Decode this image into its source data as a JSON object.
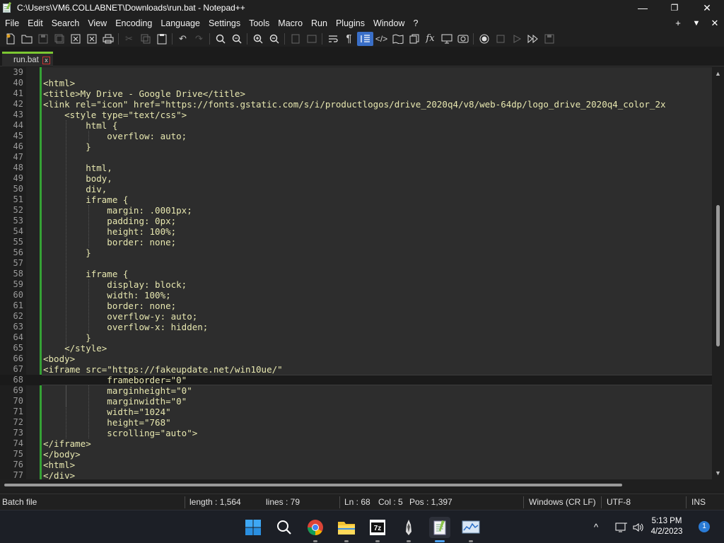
{
  "window": {
    "title": "C:\\Users\\VM6.COLLABNET\\Downloads\\run.bat - Notepad++",
    "controls": {
      "minimize": "—",
      "maximize": "❐",
      "close": "✕"
    }
  },
  "menu": {
    "items": [
      "File",
      "Edit",
      "Search",
      "View",
      "Encoding",
      "Language",
      "Settings",
      "Tools",
      "Macro",
      "Run",
      "Plugins",
      "Window",
      "?"
    ],
    "right": {
      "new_tab": "+",
      "dropdown": "▼",
      "close": "✕"
    }
  },
  "toolbar": {
    "icons": [
      "new-file-icon",
      "open-file-icon",
      "save-icon",
      "save-all-icon",
      "close-icon",
      "close-all-icon",
      "print-icon",
      "cut-icon",
      "copy-icon",
      "paste-icon",
      "undo-icon",
      "redo-icon",
      "find-icon",
      "replace-icon",
      "zoom-in-icon",
      "zoom-out-icon",
      "sync-vertical-icon",
      "sync-horizontal-icon",
      "word-wrap-icon",
      "show-all-chars-icon",
      "indent-guide-icon",
      "xml-tag-icon",
      "document-map-icon",
      "document-list-icon",
      "function-list-icon",
      "folder-as-workspace-icon",
      "monitoring-icon",
      "record-macro-icon",
      "stop-record-icon",
      "play-macro-icon",
      "run-macro-multiple-icon",
      "save-macro-icon"
    ]
  },
  "tabs": [
    {
      "label": "run.bat",
      "close": "x"
    }
  ],
  "editor": {
    "current_line": 68,
    "lines": [
      {
        "n": "39",
        "code": ""
      },
      {
        "n": "40",
        "code": "<html>"
      },
      {
        "n": "41",
        "code": "<title>My Drive - Google Drive</title>"
      },
      {
        "n": "42",
        "code": "<link rel=\"icon\" href=\"https://fonts.gstatic.com/s/i/productlogos/drive_2020q4/v8/web-64dp/logo_drive_2020q4_color_2x"
      },
      {
        "n": "43",
        "code": "    <style type=\"text/css\">"
      },
      {
        "n": "44",
        "code": "        html {"
      },
      {
        "n": "45",
        "code": "            overflow: auto;"
      },
      {
        "n": "46",
        "code": "        }"
      },
      {
        "n": "47",
        "code": ""
      },
      {
        "n": "48",
        "code": "        html,"
      },
      {
        "n": "49",
        "code": "        body,"
      },
      {
        "n": "50",
        "code": "        div,"
      },
      {
        "n": "51",
        "code": "        iframe {"
      },
      {
        "n": "52",
        "code": "            margin: .0001px;"
      },
      {
        "n": "53",
        "code": "            padding: 0px;"
      },
      {
        "n": "54",
        "code": "            height: 100%;"
      },
      {
        "n": "55",
        "code": "            border: none;"
      },
      {
        "n": "56",
        "code": "        }"
      },
      {
        "n": "57",
        "code": ""
      },
      {
        "n": "58",
        "code": "        iframe {"
      },
      {
        "n": "59",
        "code": "            display: block;"
      },
      {
        "n": "60",
        "code": "            width: 100%;"
      },
      {
        "n": "61",
        "code": "            border: none;"
      },
      {
        "n": "62",
        "code": "            overflow-y: auto;"
      },
      {
        "n": "63",
        "code": "            overflow-x: hidden;"
      },
      {
        "n": "64",
        "code": "        }"
      },
      {
        "n": "65",
        "code": "    </style>"
      },
      {
        "n": "66",
        "code": "<body>"
      },
      {
        "n": "67",
        "code": "<iframe src=\"https://fakeupdate.net/win10ue/\""
      },
      {
        "n": "68",
        "code": "            frameborder=\"0\""
      },
      {
        "n": "69",
        "code": "            marginheight=\"0\""
      },
      {
        "n": "70",
        "code": "            marginwidth=\"0\""
      },
      {
        "n": "71",
        "code": "            width=\"1024\""
      },
      {
        "n": "72",
        "code": "            height=\"768\""
      },
      {
        "n": "73",
        "code": "            scrolling=\"auto\">"
      },
      {
        "n": "74",
        "code": "</iframe>"
      },
      {
        "n": "75",
        "code": "</body>"
      },
      {
        "n": "76",
        "code": "<html>"
      },
      {
        "n": "77",
        "code": "</div>"
      }
    ]
  },
  "status": {
    "file_type": "Batch file",
    "length": "length : 1,564",
    "lines": "lines : 79",
    "ln": "Ln : 68",
    "col": "Col : 5",
    "pos": "Pos : 1,397",
    "eol": "Windows (CR LF)",
    "encoding": "UTF-8",
    "mode": "INS"
  },
  "taskbar": {
    "apps": [
      "start-icon",
      "search-icon",
      "chrome-icon",
      "file-explorer-icon",
      "7zip-icon",
      "inkscape-icon",
      "notepadpp-icon",
      "resource-monitor-icon"
    ],
    "tray": {
      "chevron": "^",
      "time": "5:13 PM",
      "date": "4/2/2023",
      "notifications": "1"
    }
  },
  "colors": {
    "accent_green": "#35a235",
    "tab_accent": "#7cc832",
    "active_tool": "#3a6fc8"
  }
}
